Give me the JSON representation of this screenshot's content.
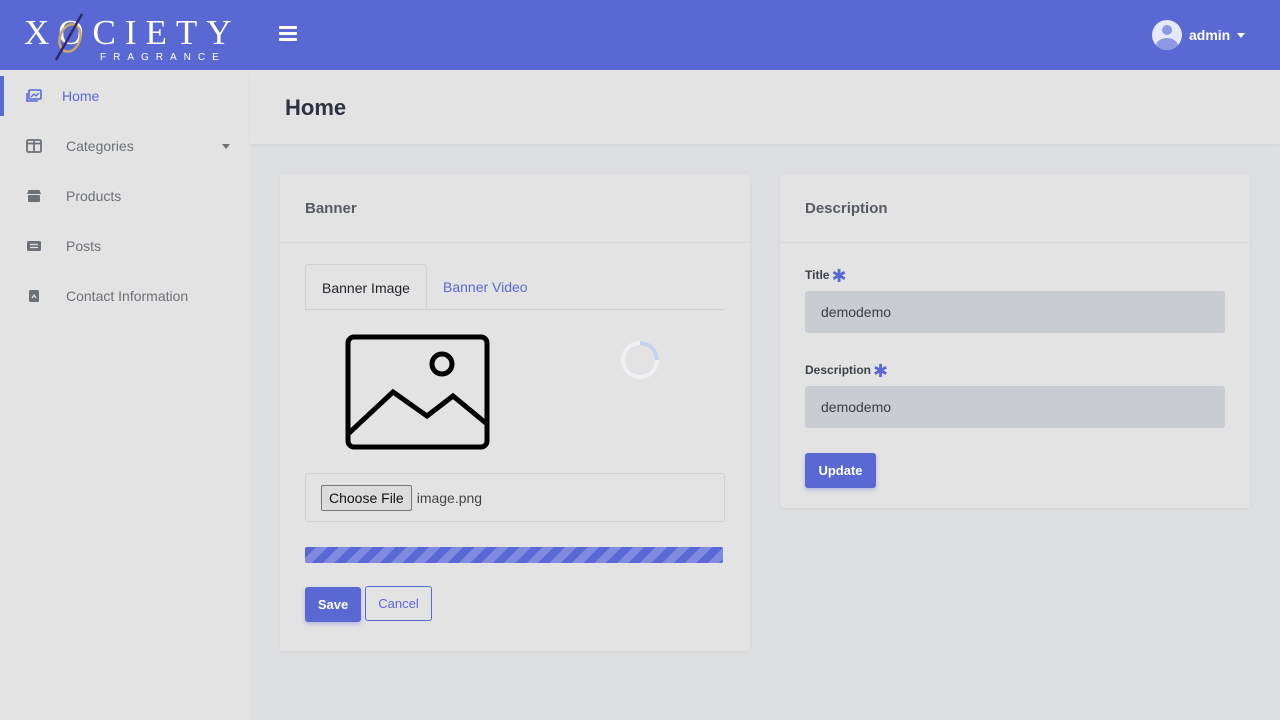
{
  "brand": {
    "name": "XOCIETY",
    "tagline": "FRAGRANCE"
  },
  "header": {
    "username": "admin"
  },
  "sidebar": {
    "items": [
      {
        "label": "Home",
        "icon": "image-icon",
        "active": true
      },
      {
        "label": "Categories",
        "icon": "columns-icon",
        "has_submenu": true
      },
      {
        "label": "Products",
        "icon": "store-icon"
      },
      {
        "label": "Posts",
        "icon": "list-icon"
      },
      {
        "label": "Contact Information",
        "icon": "contact-book-icon"
      }
    ]
  },
  "page": {
    "title": "Home"
  },
  "banner": {
    "title": "Banner",
    "tabs": [
      {
        "label": "Banner Image",
        "active": true
      },
      {
        "label": "Banner Video",
        "active": false
      }
    ],
    "file": {
      "choose_label": "Choose File",
      "file_name": "image.png"
    },
    "progress_percent": 100,
    "save_label": "Save",
    "cancel_label": "Cancel"
  },
  "description_card": {
    "title": "Description",
    "title_field": {
      "label": "Title",
      "value": "demodemo"
    },
    "description_field": {
      "label": "Description",
      "value": "demodemo"
    },
    "update_label": "Update"
  },
  "colors": {
    "accent": "#5a68d3",
    "background": "#dedfe1",
    "panel": "#e3e3e4",
    "input": "#c9ccd1"
  }
}
